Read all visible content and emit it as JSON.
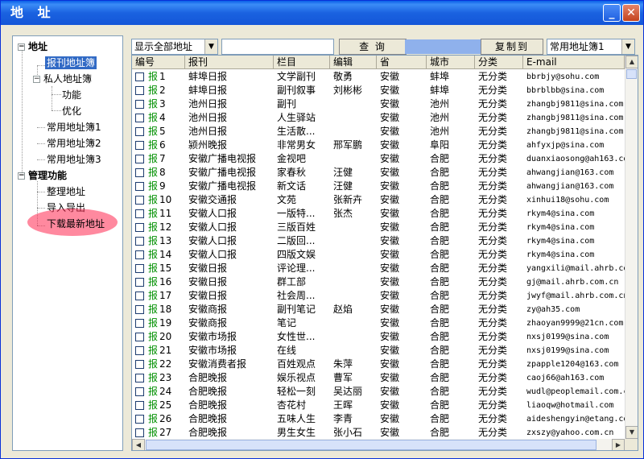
{
  "window": {
    "title": "地 址",
    "min": "_",
    "close": "✕"
  },
  "tree": {
    "addr_root": "地址",
    "bk": "报刊地址簿",
    "private": "私人地址簿",
    "func": "功能",
    "opt": "优化",
    "c1": "常用地址簿1",
    "c2": "常用地址簿2",
    "c3": "常用地址簿3",
    "mgmt": "管理功能",
    "m1": "整理地址",
    "m2": "导入导出",
    "m3": "下载最新地址",
    "minus": "−"
  },
  "toolbar": {
    "filter": "显示全部地址",
    "search_value": "",
    "query": "查 询",
    "copy": "复制到",
    "target": "常用地址簿1",
    "arrow": "▼"
  },
  "columns": [
    "编号",
    "报刊",
    "栏目",
    "编辑",
    "省",
    "城市",
    "分类",
    "E-mail"
  ],
  "rows": [
    {
      "n": "1",
      "p": "蚌埠日报",
      "c": "文学副刊",
      "e": "敬勇",
      "s": "安徽",
      "city": "蚌埠",
      "cat": "无分类",
      "m": "bbrbjy@sohu.com"
    },
    {
      "n": "2",
      "p": "蚌埠日报",
      "c": "副刊叙事",
      "e": "刘彬彬",
      "s": "安徽",
      "city": "蚌埠",
      "cat": "无分类",
      "m": "bbrblbb@sina.com"
    },
    {
      "n": "3",
      "p": "池州日报",
      "c": "副刊",
      "e": "",
      "s": "安徽",
      "city": "池州",
      "cat": "无分类",
      "m": "zhangbj9811@sina.com"
    },
    {
      "n": "4",
      "p": "池州日报",
      "c": "人生驿站",
      "e": "",
      "s": "安徽",
      "city": "池州",
      "cat": "无分类",
      "m": "zhangbj9811@sina.com"
    },
    {
      "n": "5",
      "p": "池州日报",
      "c": "生活散...",
      "e": "",
      "s": "安徽",
      "city": "池州",
      "cat": "无分类",
      "m": "zhangbj9811@sina.com"
    },
    {
      "n": "6",
      "p": "颍州晚报",
      "c": "非常男女",
      "e": "邢军鹏",
      "s": "安徽",
      "city": "阜阳",
      "cat": "无分类",
      "m": "ahfyxjp@sina.com"
    },
    {
      "n": "7",
      "p": "安徽广播电视报",
      "c": "金视吧",
      "e": "",
      "s": "安徽",
      "city": "合肥",
      "cat": "无分类",
      "m": "duanxiaosong@ah163.com"
    },
    {
      "n": "8",
      "p": "安徽广播电视报",
      "c": "家春秋",
      "e": "汪健",
      "s": "安徽",
      "city": "合肥",
      "cat": "无分类",
      "m": "ahwangjian@163.com"
    },
    {
      "n": "9",
      "p": "安徽广播电视报",
      "c": "新文话",
      "e": "汪健",
      "s": "安徽",
      "city": "合肥",
      "cat": "无分类",
      "m": "ahwangjian@163.com"
    },
    {
      "n": "10",
      "p": "安徽交通报",
      "c": "文苑",
      "e": "张新卉",
      "s": "安徽",
      "city": "合肥",
      "cat": "无分类",
      "m": "xinhui18@sohu.com"
    },
    {
      "n": "11",
      "p": "安徽人口报",
      "c": "一版特...",
      "e": "张杰",
      "s": "安徽",
      "city": "合肥",
      "cat": "无分类",
      "m": "rkym4@sina.com"
    },
    {
      "n": "12",
      "p": "安徽人口报",
      "c": "三版百姓",
      "e": "",
      "s": "安徽",
      "city": "合肥",
      "cat": "无分类",
      "m": "rkym4@sina.com"
    },
    {
      "n": "13",
      "p": "安徽人口报",
      "c": "二版回...",
      "e": "",
      "s": "安徽",
      "city": "合肥",
      "cat": "无分类",
      "m": "rkym4@sina.com"
    },
    {
      "n": "14",
      "p": "安徽人口报",
      "c": "四版文娱",
      "e": "",
      "s": "安徽",
      "city": "合肥",
      "cat": "无分类",
      "m": "rkym4@sina.com"
    },
    {
      "n": "15",
      "p": "安徽日报",
      "c": "评论理...",
      "e": "",
      "s": "安徽",
      "city": "合肥",
      "cat": "无分类",
      "m": "yangxili@mail.ahrb.co"
    },
    {
      "n": "16",
      "p": "安徽日报",
      "c": "群工部",
      "e": "",
      "s": "安徽",
      "city": "合肥",
      "cat": "无分类",
      "m": "gj@mail.ahrb.com.cn"
    },
    {
      "n": "17",
      "p": "安徽日报",
      "c": "社会周...",
      "e": "",
      "s": "安徽",
      "city": "合肥",
      "cat": "无分类",
      "m": "jwyf@mail.ahrb.com.cn"
    },
    {
      "n": "18",
      "p": "安徽商报",
      "c": "副刊笔记",
      "e": "赵焰",
      "s": "安徽",
      "city": "合肥",
      "cat": "无分类",
      "m": "zy@ah35.com"
    },
    {
      "n": "19",
      "p": "安徽商报",
      "c": "笔记",
      "e": "",
      "s": "安徽",
      "city": "合肥",
      "cat": "无分类",
      "m": "zhaoyan9999@21cn.com"
    },
    {
      "n": "20",
      "p": "安徽市场报",
      "c": "女性世...",
      "e": "",
      "s": "安徽",
      "city": "合肥",
      "cat": "无分类",
      "m": "nxsj0199@sina.com"
    },
    {
      "n": "21",
      "p": "安徽市场报",
      "c": "在线",
      "e": "",
      "s": "安徽",
      "city": "合肥",
      "cat": "无分类",
      "m": "nxsj0199@sina.com"
    },
    {
      "n": "22",
      "p": "安徽消费者报",
      "c": "百姓观点",
      "e": "朱萍",
      "s": "安徽",
      "city": "合肥",
      "cat": "无分类",
      "m": "zpapple1204@163.com"
    },
    {
      "n": "23",
      "p": "合肥晚报",
      "c": "娱乐视点",
      "e": "曹军",
      "s": "安徽",
      "city": "合肥",
      "cat": "无分类",
      "m": "caoj66@ah163.com"
    },
    {
      "n": "24",
      "p": "合肥晚报",
      "c": "轻松一刻",
      "e": "吴达丽",
      "s": "安徽",
      "city": "合肥",
      "cat": "无分类",
      "m": "wudl@peoplemail.com.c"
    },
    {
      "n": "25",
      "p": "合肥晚报",
      "c": "杏花村",
      "e": "王晖",
      "s": "安徽",
      "city": "合肥",
      "cat": "无分类",
      "m": "liaoqw@hotmail.com"
    },
    {
      "n": "26",
      "p": "合肥晚报",
      "c": "五味人生",
      "e": "李青",
      "s": "安徽",
      "city": "合肥",
      "cat": "无分类",
      "m": "aideshengyin@etang.co"
    },
    {
      "n": "27",
      "p": "合肥晚报",
      "c": "男生女生",
      "e": "张小石",
      "s": "安徽",
      "city": "合肥",
      "cat": "无分类",
      "m": "zxszy@yahoo.com.cn"
    }
  ],
  "row_mark": "报",
  "scroll": {
    "up": "▲",
    "down": "▼",
    "left": "◀",
    "right": "▶"
  }
}
